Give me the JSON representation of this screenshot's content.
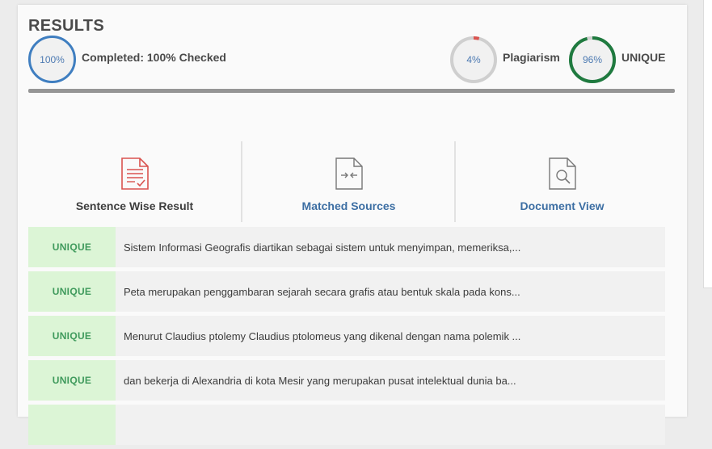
{
  "header": {
    "title": "RESULTS"
  },
  "completed": {
    "percent_text": "100%",
    "label": "Completed: 100% Checked"
  },
  "plagiarism": {
    "percent_text": "4%",
    "label": "Plagiarism",
    "value": 4,
    "color": "#d9534f"
  },
  "unique": {
    "percent_text": "96%",
    "label": "UNIQUE",
    "value": 96,
    "color": "#1f7a3f"
  },
  "tabs": [
    {
      "label": "Sentence Wise Result",
      "icon": "document-check-icon"
    },
    {
      "label": "Matched Sources",
      "icon": "document-compare-icon"
    },
    {
      "label": "Document View",
      "icon": "document-search-icon"
    }
  ],
  "rows": [
    {
      "badge": "UNIQUE",
      "text": "Sistem Informasi Geografis diartikan sebagai sistem untuk menyimpan, memeriksa,..."
    },
    {
      "badge": "UNIQUE",
      "text": "Peta merupakan penggambaran sejarah secara grafis atau bentuk skala pada kons..."
    },
    {
      "badge": "UNIQUE",
      "text": "Menurut Claudius ptolemy Claudius ptolomeus yang dikenal dengan nama polemik ..."
    },
    {
      "badge": "UNIQUE",
      "text": "dan bekerja di Alexandria di kota Mesir yang merupakan pusat intelektual dunia ba..."
    }
  ]
}
